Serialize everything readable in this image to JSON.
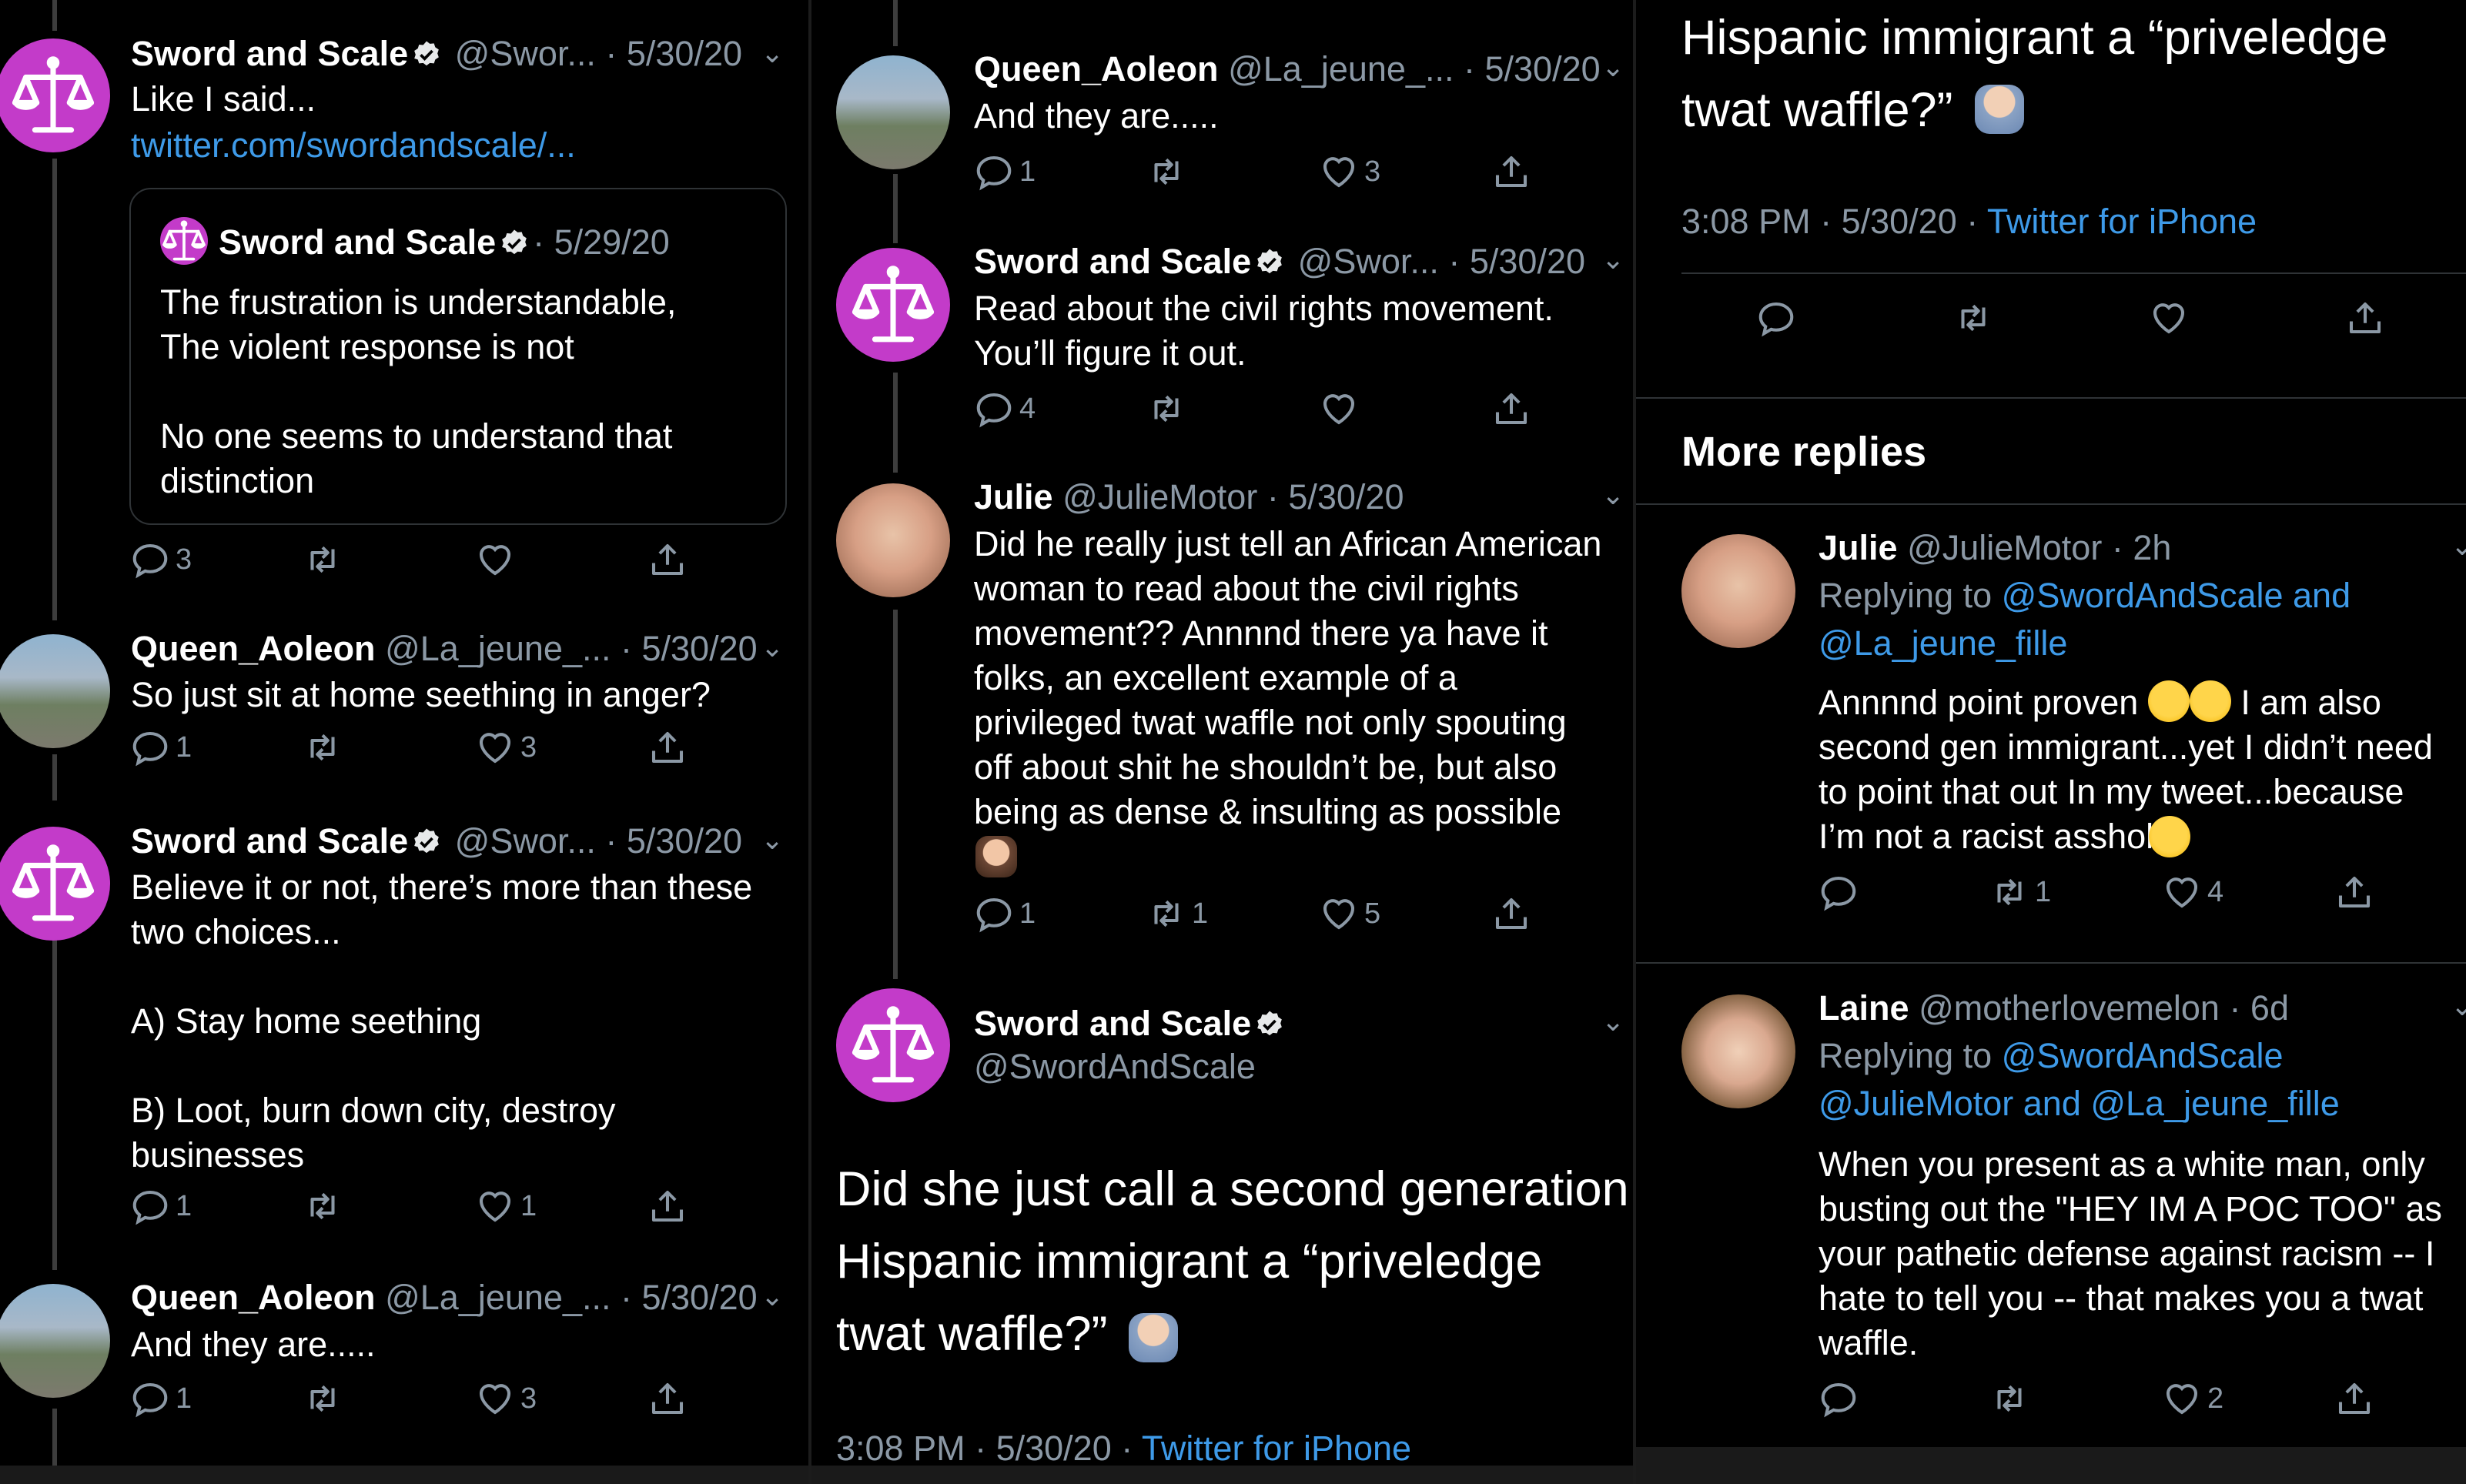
{
  "panel1": {
    "tweet1": {
      "name": "Sword and Scale",
      "handle": "@Swor...",
      "date": "· 5/30/20",
      "text": "Like I said...",
      "link": "twitter.com/swordandscale/...",
      "quote": {
        "name": "Sword and Scale",
        "date": "· 5/29/20",
        "text": "The frustration is understandable,\nThe violent response is not\n\nNo one seems to understand that\ndistinction"
      },
      "reply_count": "3",
      "retweet_count": "",
      "like_count": ""
    },
    "tweet2": {
      "name": "Queen_Aoleon",
      "handle": "@La_jeune_...",
      "date": "· 5/30/20",
      "text": "So just sit at home seething in anger?",
      "reply_count": "1",
      "retweet_count": "",
      "like_count": "3"
    },
    "tweet3": {
      "name": "Sword and Scale",
      "handle": "@Swor...",
      "date": "· 5/30/20",
      "text": "Believe it or not, there’s more than these\ntwo choices...\n\nA) Stay home seething\n\nB) Loot, burn down city, destroy\nbusinesses",
      "reply_count": "1",
      "retweet_count": "",
      "like_count": "1"
    },
    "tweet4": {
      "name": "Queen_Aoleon",
      "handle": "@La_jeune_...",
      "date": "· 5/30/20",
      "text": "And they are.....",
      "reply_count": "1",
      "retweet_count": "",
      "like_count": "3"
    }
  },
  "panel2": {
    "tweet1": {
      "name": "Queen_Aoleon",
      "handle": "@La_jeune_...",
      "date": "· 5/30/20",
      "text": "And they are.....",
      "reply_count": "1",
      "retweet_count": "",
      "like_count": "3"
    },
    "tweet2": {
      "name": "Sword and Scale",
      "handle": "@Swor...",
      "date": "· 5/30/20",
      "text": "Read about the civil rights movement.\nYou’ll figure it out.",
      "reply_count": "4",
      "retweet_count": "",
      "like_count": ""
    },
    "tweet3": {
      "name": "Julie",
      "handle": "@JulieMotor",
      "date": "· 5/30/20",
      "text": "Did he really just tell an African American\nwoman to read about the civil rights\nmovement?? Annnnd there ya have it\nfolks, an excellent example of a\nprivileged twat waffle not only spouting\noff about shit he shouldn’t be, but also\nbeing as dense & insulting as possible",
      "reply_count": "1",
      "retweet_count": "1",
      "like_count": "5"
    },
    "main": {
      "name": "Sword and Scale",
      "handle": "@SwordAndScale",
      "text": "Did she just call a second generation\nHispanic immigrant a “priveledge\ntwat waffle?”",
      "time": "3:08 PM · 5/30/20 ·",
      "source": "Twitter for iPhone"
    }
  },
  "panel3": {
    "main_text": "Hispanic immigrant a “priveledge\ntwat waffle?”",
    "time": "3:08 PM · 5/30/20 ·",
    "source": "Twitter for iPhone",
    "more_replies": "More replies",
    "reply1": {
      "name": "Julie",
      "handle": "@JulieMotor",
      "date": "· 2h",
      "replying_prefix": "Replying to",
      "replying_line1": "@SwordAndScale and",
      "replying_line2": "@La_jeune_fille",
      "text_a": "Annnnd point proven",
      "text_b": "I am also",
      "text_c": "second gen immigrant...yet I didn’t need\nto point that out In my tweet...because\nI’m not a racist asshole",
      "reply_count": "",
      "retweet_count": "1",
      "like_count": "4"
    },
    "reply2": {
      "name": "Laine",
      "handle": "@motherlovemelon",
      "date": "· 6d",
      "replying_prefix": "Replying to",
      "replying_line1": "@SwordAndScale",
      "replying_line2": "@JulieMotor and @La_jeune_fille",
      "text": "When you present as a white man, only\nbusting out the \"HEY IM A POC TOO\" as\nyour pathetic defense against racism -- I\nhate to tell you -- that makes you a twat\nwaffle.",
      "reply_count": "",
      "retweet_count": "",
      "like_count": "2"
    }
  },
  "icons": {
    "reply": "reply-icon",
    "retweet": "retweet-icon",
    "like": "heart-icon",
    "share": "share-icon",
    "verified": "verified-badge-icon",
    "chevron": "chevron-down-icon"
  },
  "colors": {
    "background": "#000000",
    "link": "#3e9ae8",
    "muted": "#8b98a5",
    "brand_avatar": "#c33bc9"
  }
}
